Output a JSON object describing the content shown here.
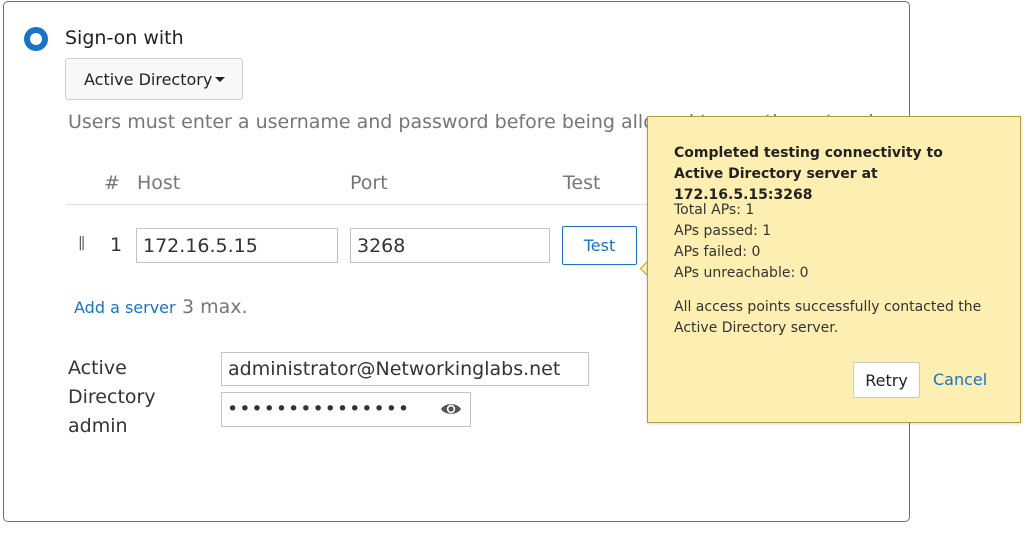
{
  "auth": {
    "title": "Sign-on with",
    "dropdown_value": "Active Directory",
    "description": "Users must enter a username and password before being allowed to use the network"
  },
  "table": {
    "headers": [
      "#",
      "Host",
      "Port",
      "Test"
    ],
    "rows": [
      {
        "index": "1",
        "host": "172.16.5.15",
        "port": "3268",
        "test_label": "Test"
      }
    ]
  },
  "add_server": {
    "label": "Add a server",
    "note": "3 max."
  },
  "admin": {
    "label_lines": [
      "Active",
      "Directory",
      "admin"
    ],
    "username": "administrator@Networkinglabs.net",
    "password_mask": "•••••••••••••••"
  },
  "popover": {
    "title": "Completed testing connectivity to Active Directory server at 172.16.5.15:3268",
    "stats": [
      "Total APs: 1",
      "APs passed: 1",
      "APs failed: 0",
      "APs unreachable: 0"
    ],
    "message": "All access points successfully contacted the Active Directory server.",
    "retry_label": "Retry",
    "cancel_label": "Cancel"
  },
  "icons": {
    "radio": "radio-selected-icon",
    "caret": "caret-down-icon",
    "drag": "drag-handle-icon",
    "eye": "eye-icon"
  },
  "colors": {
    "accent": "#1a72c8",
    "popover_bg": "#fdefb2",
    "border": "#3a7ca5"
  }
}
